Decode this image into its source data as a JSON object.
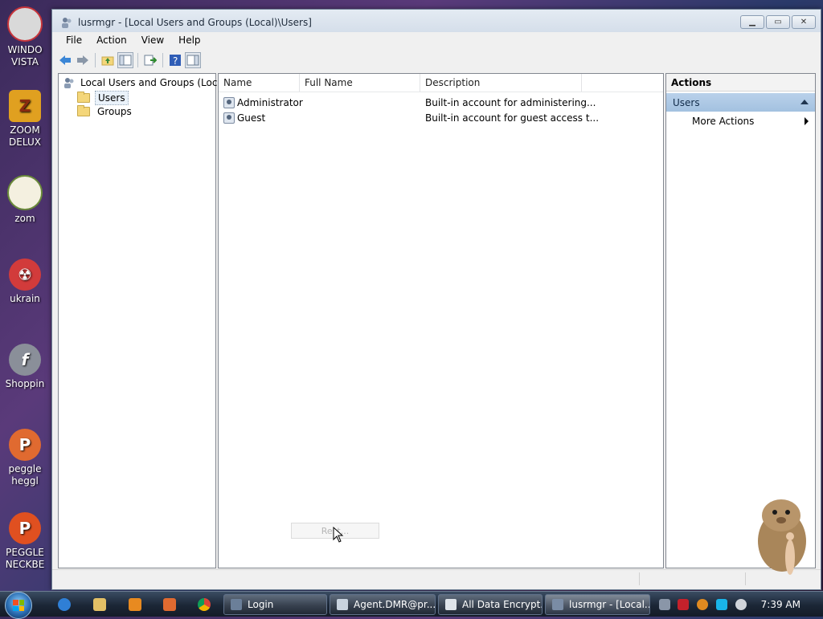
{
  "window": {
    "title": "lusrmgr - [Local Users and Groups (Local)\\Users]"
  },
  "menu": [
    "File",
    "Action",
    "View",
    "Help"
  ],
  "tree": {
    "root": "Local Users and Groups (Local)",
    "children": [
      "Users",
      "Groups"
    ]
  },
  "list": {
    "columns": [
      "Name",
      "Full Name",
      "Description"
    ],
    "rows": [
      {
        "name": "Administrator",
        "full_name": "",
        "description": "Built-in account for administering..."
      },
      {
        "name": "Guest",
        "full_name": "",
        "description": "Built-in account for guest access t..."
      }
    ],
    "ghost_button": "Rest..."
  },
  "actions": {
    "title": "Actions",
    "group": "Users",
    "item": "More Actions"
  },
  "desktop_icons": [
    {
      "label": "WINDO",
      "label2": "VISTA",
      "color": "#c7343a"
    },
    {
      "label": "ZOOM",
      "label2": "DELUX",
      "color": "#e0a020"
    },
    {
      "label": "zom",
      "label2": "",
      "color": "#6a8a3a"
    },
    {
      "label": "ukrain",
      "label2": "",
      "color": "#d23b3b"
    },
    {
      "label": "Shoppin",
      "label2": "",
      "color": "#8a8f99"
    },
    {
      "label": "peggle",
      "label2": "heggl",
      "color": "#e06a30"
    },
    {
      "label": "PEGGLE",
      "label2": "NECKBE",
      "color": "#e05020"
    }
  ],
  "taskbar": {
    "buttons": [
      {
        "label": "Login",
        "icon_color": "#6b7f99"
      },
      {
        "label": "Agent.DMR@pr...",
        "icon_color": "#c9d3df"
      },
      {
        "label": "All Data Encrypt...",
        "icon_color": "#dfe4ea"
      },
      {
        "label": "lusrmgr - [Local...",
        "icon_color": "#7a8ca5"
      }
    ],
    "clock": "7:39 AM"
  },
  "colors": {
    "accent": "#a3c1e0",
    "selection": "#eaf2fa"
  }
}
